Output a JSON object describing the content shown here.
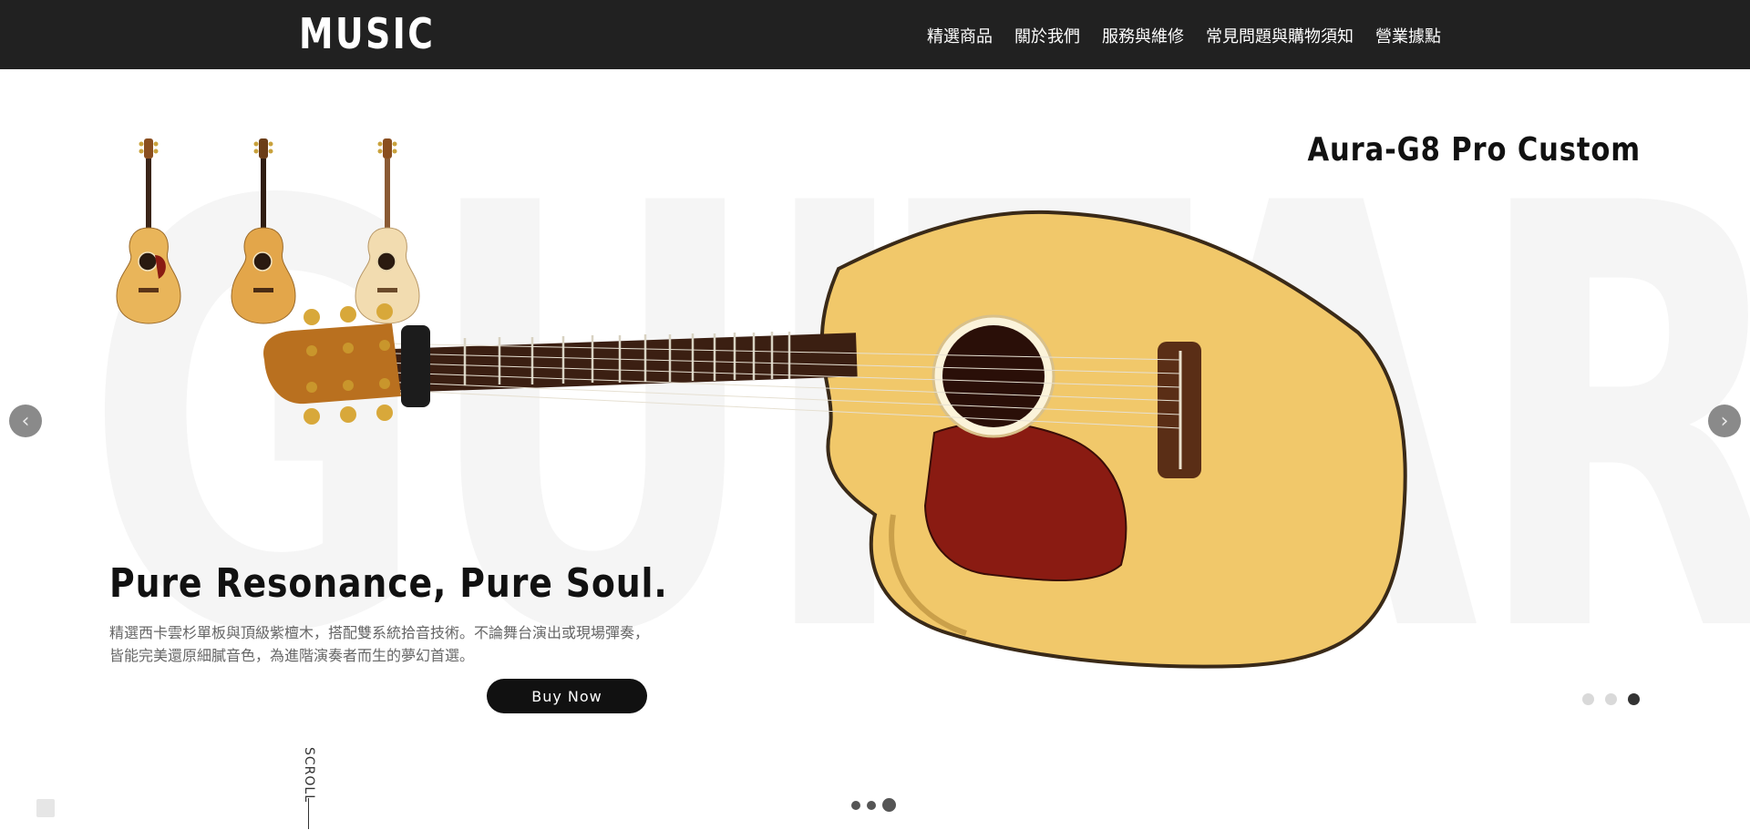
{
  "header": {
    "logo": "MUSIC",
    "nav": [
      "精選商品",
      "關於我們",
      "服務與維修",
      "常見問題與購物須知",
      "營業據點"
    ]
  },
  "hero": {
    "background_word": "GUITAR",
    "product_title": "Aura-G8 Pro Custom",
    "headline": "Pure Resonance, Pure Soul.",
    "description": "精選西卡雲杉單板與頂級紫檀木，搭配雙系統拾音技術。不論舞台演出或現場彈奏，皆能完美還原細膩音色，為進階演奏者而生的夢幻首選。",
    "buy_label": "Buy Now",
    "prev_icon": "‹",
    "next_icon": "›",
    "slides": 3,
    "active_slide": 3
  },
  "footer": {
    "scroll_label": "SCROLL"
  },
  "colors": {
    "header_bg": "#212121",
    "button_bg": "#111111",
    "guitar_top": "#f1c86a",
    "pickguard": "#8a1b12"
  }
}
